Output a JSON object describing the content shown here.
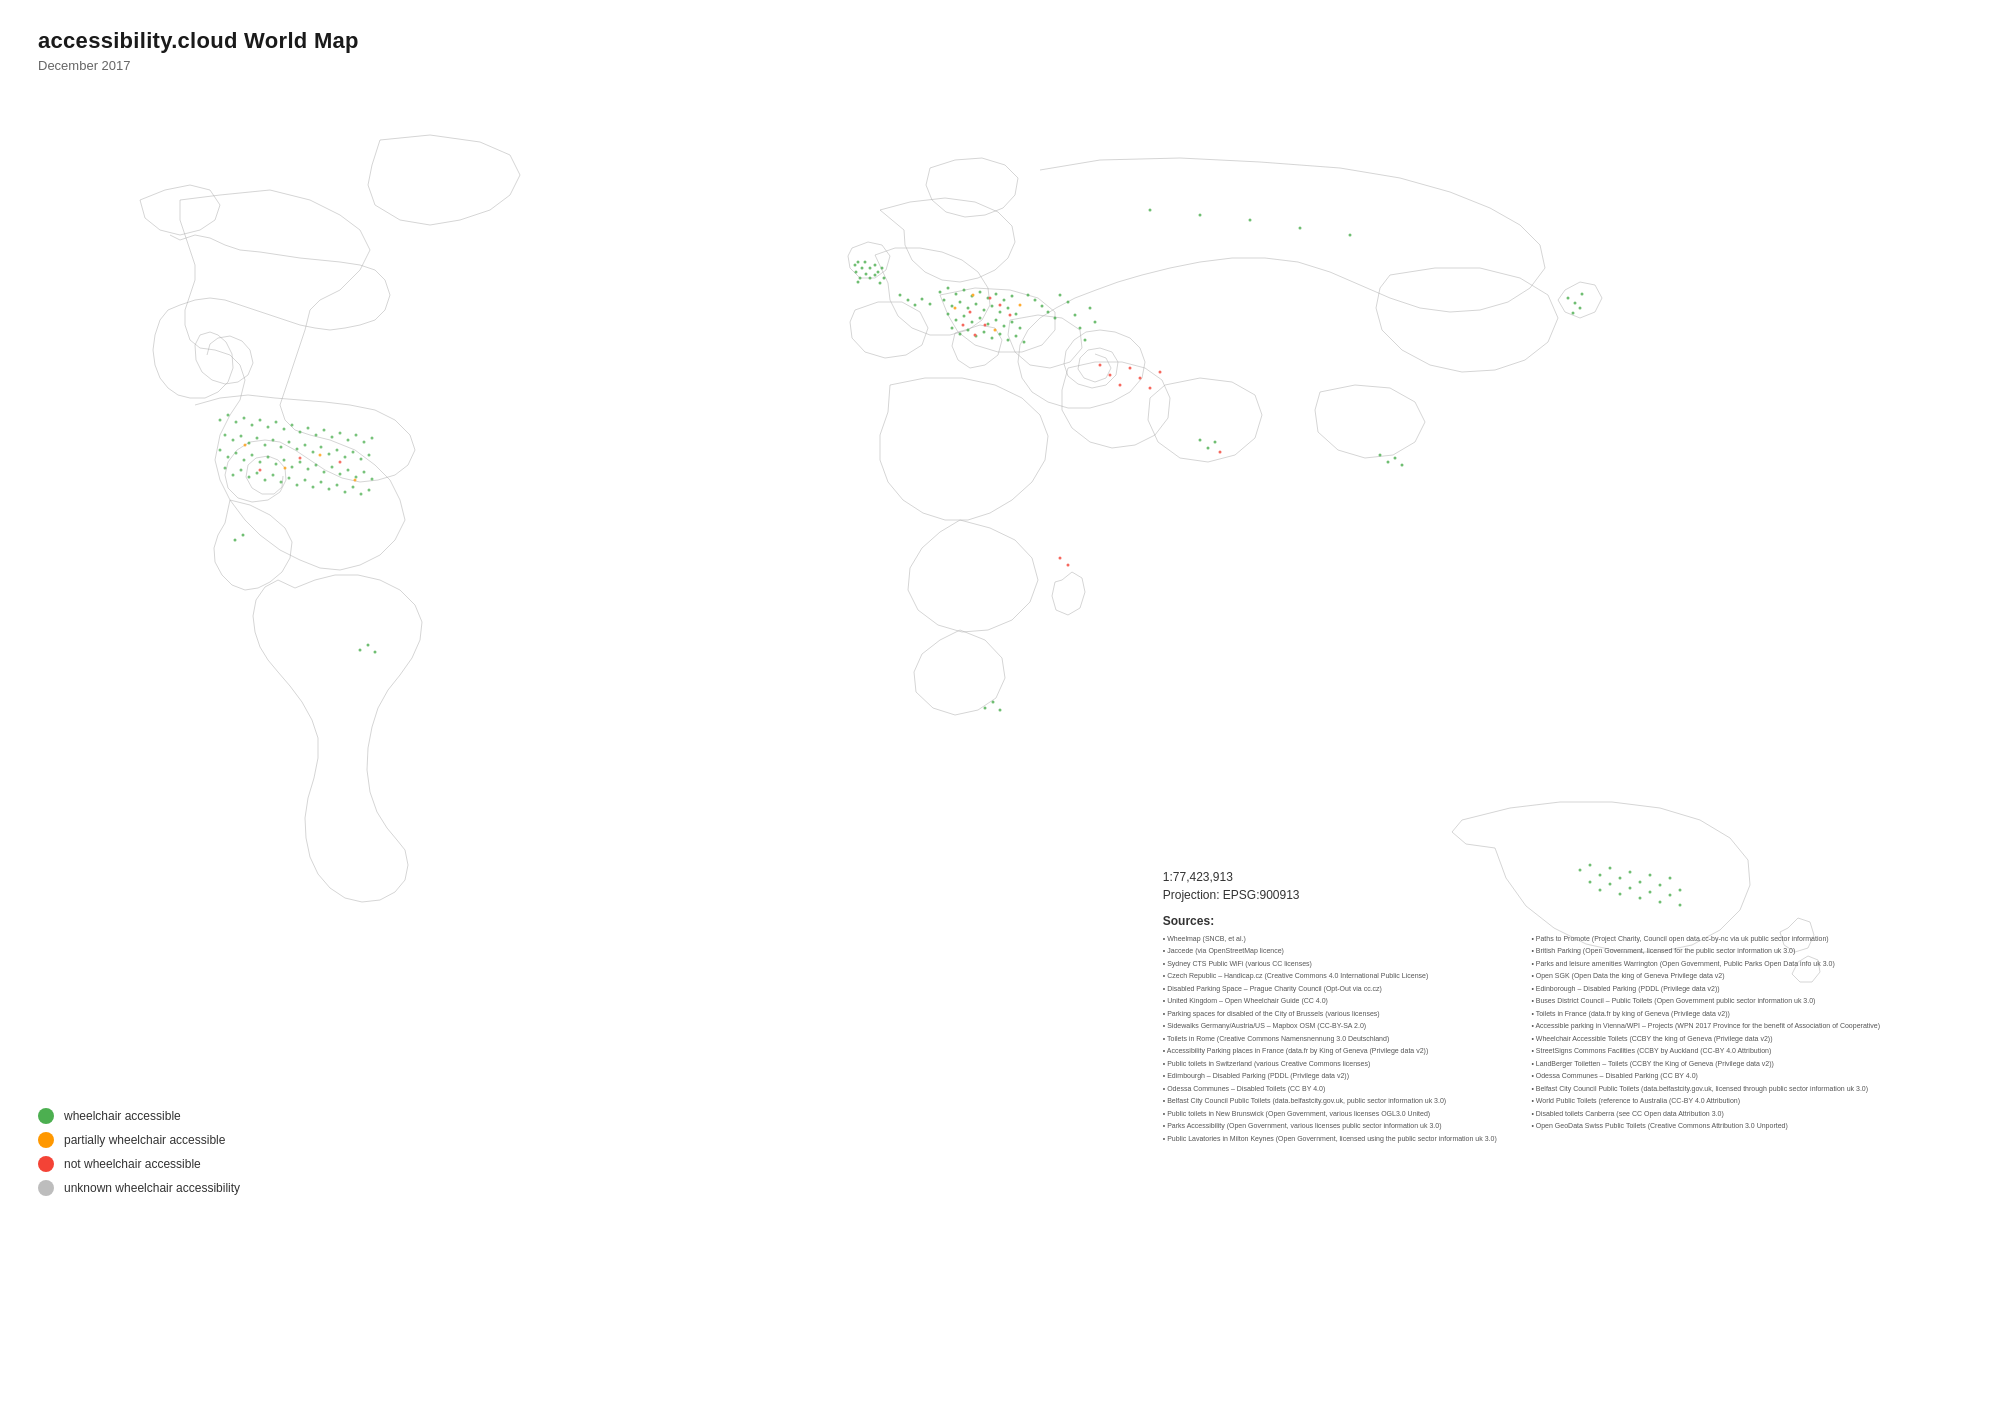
{
  "title": {
    "main": "accessibility.cloud World Map",
    "sub": "December 2017"
  },
  "legend": {
    "items": [
      {
        "color": "#4caf50",
        "label": "wheelchair accessible"
      },
      {
        "color": "#ff9800",
        "label": "partially wheelchair accessible"
      },
      {
        "color": "#f44336",
        "label": "not wheelchair accessible"
      },
      {
        "color": "#bdbdbd",
        "label": "unknown wheelchair accessibility"
      }
    ]
  },
  "mapInfo": {
    "scale": "1:77,423,913",
    "projection": "Projection: EPSG:900913",
    "sourcesTitle": "Sources:"
  },
  "sources": [
    "Wheelmap (SNCB, et al.)",
    "Jaccede (via OpenStreetMap licence)",
    "Sydney CTS Public WiFi (various CC licenses)",
    "Czech Republic – Handicap.cz (Creative Commons 4.0 International Public License)",
    "Disabled Parking Space – Prague Charity Council (Opt-Out via cc.cz)",
    "United Kingdom – Open Wheelchair Guide (CC 4.0)",
    "Parking spaces for disabled of the City of Brussels (various licenses)",
    "Sidewalks Germany/Austria/US – Mapbox OSM (CC-BY-SA 2.0)",
    "Toilets in Rome (Creative Commons Namensnennung 3.0 Deutschland)",
    "Accessibility Parking places in France (data.fr by King of Geneva (Privilege data v2))",
    "Public toilets in Switzerland (various Creative Commons licenses)",
    "Edimbourgh – Disabled Parking (PDDL (Privilege data v2))",
    "Odessa Communes – Disabled Toilets (CC BY 4.0)",
    "Belfast City Council Public Toilets (data.belfastcity.gov.uk, public sector information uk 3.0)",
    "Public toilets in New Brunswick (Open Government, various licenses OGL3.0 United)",
    "Parks Accessibility (Open Government, various licenses public sector information uk 3.0)",
    "Public Lavatories in Milton Keynes (Open Government, licensed using the public sector information uk 3.0)",
    "Paths to Promote (Project Charity, Council open data cc-by-nc via uk public sector information)",
    "British Parking (Open Government, licensed for the public sector information uk 3.0)",
    "Parks and leisure amenities Warrington (Open Government, Public Parks Open Data info uk 3.0)",
    "Open SGK (Open Data the king of Geneva Privilege data v2)",
    "Edinborough – Disabled Parking (PDDL (Privilege data v2))",
    "Buses District Council – Public Toilets (Open Government public sector information uk 3.0)",
    "Toilets in France (data.fr by king of Geneva (Privilege data v2))",
    "Accessible parking in Vienna/WPI – Projects (WPN 2017 Province for the benefit of Association of Cooperative)",
    "Wheelchair Accessible Toilets (CCBY the king of Geneva (Privilege data v2))",
    "StreetSigns Commons Facilities (CCBY by Auckland (CC-BY 4.0 Attribution)",
    "LandBerger Toiletten – Toilets (CCBY the King of Geneva (Privilege data v2))",
    "Odessa Communes – Disabled Parking (CC BY 4.0)",
    "Belfast City Council Public Toilets (data.belfastcity.gov.uk, licensed through public sector information uk 3.0)",
    "World Public Toilets (reference to Australia (CC-BY 4.0 Attribution)",
    "Disabled toilets Canberra (see CC Open data Attribution 3.0)",
    "Open GeoData Swiss Public Toilets (Creative Commons Attribution 3.0 Unported)"
  ]
}
